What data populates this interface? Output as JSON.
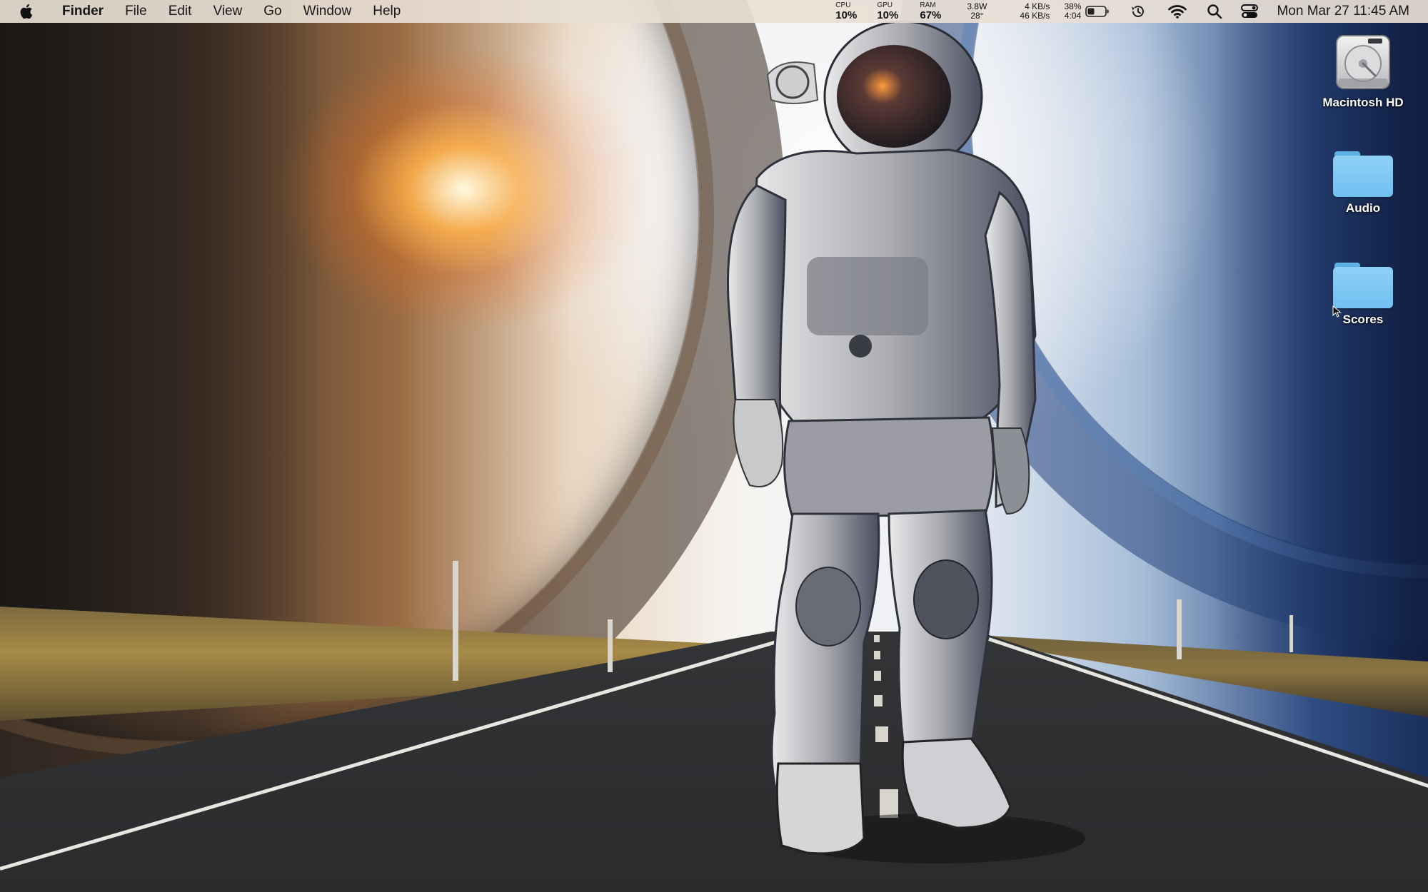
{
  "menubar": {
    "app_name": "Finder",
    "menus": [
      "File",
      "Edit",
      "View",
      "Go",
      "Window",
      "Help"
    ],
    "stats": {
      "cpu_label": "CPU",
      "cpu_value": "10%",
      "gpu_label": "GPU",
      "gpu_value": "10%",
      "ram_label": "RAM",
      "ram_value": "67%",
      "power": "3.8W",
      "temperature": "28°",
      "net_up": "4 KB/s",
      "net_down": "46 KB/s",
      "battery_percent": "38%",
      "battery_time": "4:04"
    },
    "icons": [
      "battery-icon",
      "time-machine-icon",
      "wifi-icon",
      "spotlight-search-icon",
      "control-center-icon"
    ],
    "clock": "Mon Mar 27  11:45 AM"
  },
  "desktop": {
    "icons": [
      {
        "label": "Macintosh HD",
        "type": "hard-drive-icon"
      },
      {
        "label": "Audio",
        "type": "folder-icon"
      },
      {
        "label": "Scores",
        "type": "folder-icon"
      }
    ]
  },
  "colors": {
    "menubar_bg": "#e8ded4",
    "folder_blue": "#7cc6f2"
  }
}
